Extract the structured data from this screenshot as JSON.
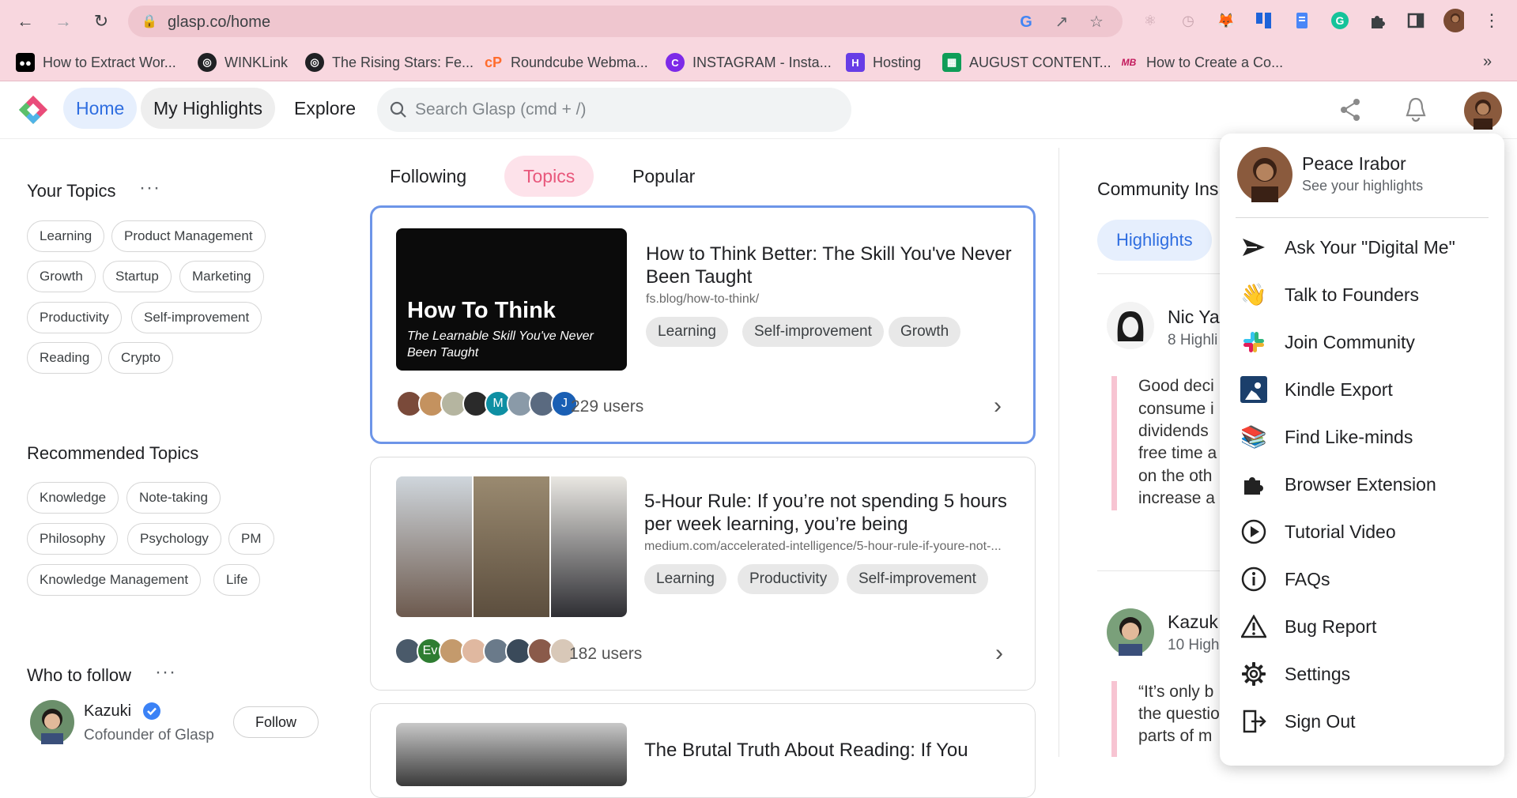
{
  "browser": {
    "url": "glasp.co/home",
    "bookmarks": [
      {
        "label": "How to Extract Wor...",
        "icon": "medium-icon",
        "color": "#000000"
      },
      {
        "label": "WINKLink",
        "icon": "globe-icon",
        "color": "#202124"
      },
      {
        "label": "The Rising Stars: Fe...",
        "icon": "globe-icon",
        "color": "#202124"
      },
      {
        "label": "Roundcube Webma...",
        "icon": "cpanel-icon",
        "color": "#ff6c2c"
      },
      {
        "label": "INSTAGRAM - Insta...",
        "icon": "canva-icon",
        "color": "#7d2ae8"
      },
      {
        "label": "Hosting",
        "icon": "hosting-icon",
        "color": "#673de6"
      },
      {
        "label": "AUGUST CONTENT...",
        "icon": "sheets-icon",
        "color": "#0f9d58"
      },
      {
        "label": "How to Create a Co...",
        "icon": "site-icon",
        "color": "#c2185b"
      }
    ]
  },
  "header": {
    "nav": [
      "Home",
      "My Highlights",
      "Explore"
    ],
    "search_placeholder": "Search Glasp (cmd + /)"
  },
  "sidebar": {
    "your_topics_title": "Your Topics",
    "your_topics": [
      "Learning",
      "Product Management",
      "Growth",
      "Startup",
      "Marketing",
      "Productivity",
      "Self-improvement",
      "Reading",
      "Crypto"
    ],
    "recommended_title": "Recommended Topics",
    "recommended": [
      "Knowledge",
      "Note-taking",
      "Philosophy",
      "Psychology",
      "PM",
      "Knowledge Management",
      "Life"
    ],
    "who_to_follow_title": "Who to follow",
    "follow": {
      "name": "Kazuki",
      "subtitle": "Cofounder of Glasp",
      "button": "Follow"
    }
  },
  "feed": {
    "tabs": [
      "Following",
      "Topics",
      "Popular"
    ],
    "active_tab": "Topics",
    "cards": [
      {
        "thumb_title": "How To Think",
        "thumb_subtitle": "The Learnable Skill You've Never Been Taught",
        "title": "How to Think Better: The Skill You've Never Been Taught",
        "url": "fs.blog/how-to-think/",
        "tags": [
          "Learning",
          "Self-improvement",
          "Growth"
        ],
        "avatars": [
          "",
          "",
          "",
          "",
          "M",
          "",
          "",
          "J"
        ],
        "users": "229 users"
      },
      {
        "title": "5-Hour Rule: If you’re not spending 5 hours per week learning, you’re being",
        "url": "medium.com/accelerated-intelligence/5-hour-rule-if-youre-not-...",
        "tags": [
          "Learning",
          "Productivity",
          "Self-improvement"
        ],
        "avatars": [
          "",
          "Ev",
          "",
          "",
          "",
          "",
          "",
          ""
        ],
        "users": "182 users"
      },
      {
        "title": "The Brutal Truth About Reading: If You"
      }
    ]
  },
  "community": {
    "title": "Community Ins",
    "tab": "Highlights",
    "items": [
      {
        "name": "Nic Ya",
        "sub": "8 Highli",
        "quote": [
          "Good deci",
          "consume i",
          "dividends",
          "free time a",
          "on the oth",
          "increase a"
        ]
      },
      {
        "name": "Kazuk",
        "sub": "10 High",
        "quote": [
          "“It’s only b",
          "the questio",
          "parts of m"
        ]
      }
    ]
  },
  "menu": {
    "user_name": "Peace Irabor",
    "user_sub": "See your highlights",
    "items": [
      {
        "label": "Ask Your \"Digital Me\"",
        "icon": "send-icon"
      },
      {
        "label": "Talk to Founders",
        "icon": "wave-icon"
      },
      {
        "label": "Join Community",
        "icon": "slack-icon"
      },
      {
        "label": "Kindle Export",
        "icon": "kindle-icon"
      },
      {
        "label": "Find Like-minds",
        "icon": "books-icon"
      },
      {
        "label": "Browser Extension",
        "icon": "puzzle-icon"
      },
      {
        "label": "Tutorial Video",
        "icon": "play-icon"
      },
      {
        "label": "FAQs",
        "icon": "info-icon"
      },
      {
        "label": "Bug Report",
        "icon": "warning-icon"
      },
      {
        "label": "Settings",
        "icon": "gear-icon"
      },
      {
        "label": "Sign Out",
        "icon": "sign-out-icon"
      }
    ]
  },
  "colors": {
    "accent": "#3b82f6",
    "pink_tab": "#fde2ea",
    "pink_text": "#e8577b",
    "chrome": "#f8d7df"
  }
}
